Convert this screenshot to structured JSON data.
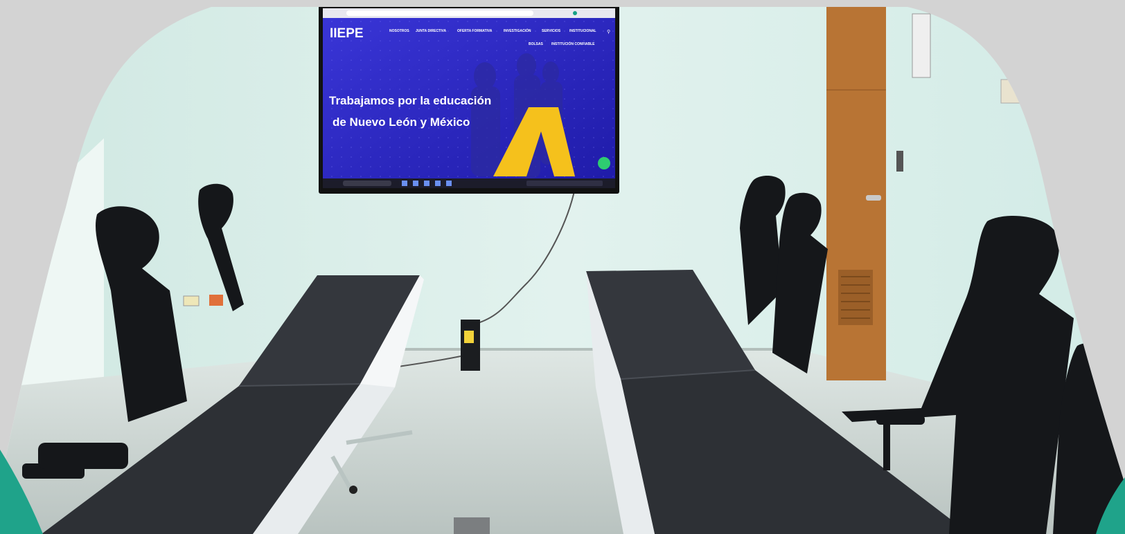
{
  "screen": {
    "logo": "IIEPE",
    "nav_row1": [
      "NOSOTROS",
      "JUNTA DIRECTIVA",
      "OFERTA FORMATIVA",
      "INVESTIGACIÓN",
      "SERVICIOS",
      "INSTITUCIONAL"
    ],
    "nav_row2": [
      "BOLSAS",
      "INSTITUCIÓN CONFIABLE"
    ],
    "headline_line1": "Trabajamos por la educación",
    "headline_line2": "de Nuevo León y México"
  },
  "colors": {
    "background": "#d3d3d3",
    "wall": "#d6ece6",
    "floor": "#c9d3cf",
    "table_top": "#34373d",
    "chair": "#15171a",
    "door": "#b87434",
    "screen_blue": "#2a26c9",
    "accent_yellow": "#f5c11c",
    "teal_corner": "#1fa38a"
  }
}
